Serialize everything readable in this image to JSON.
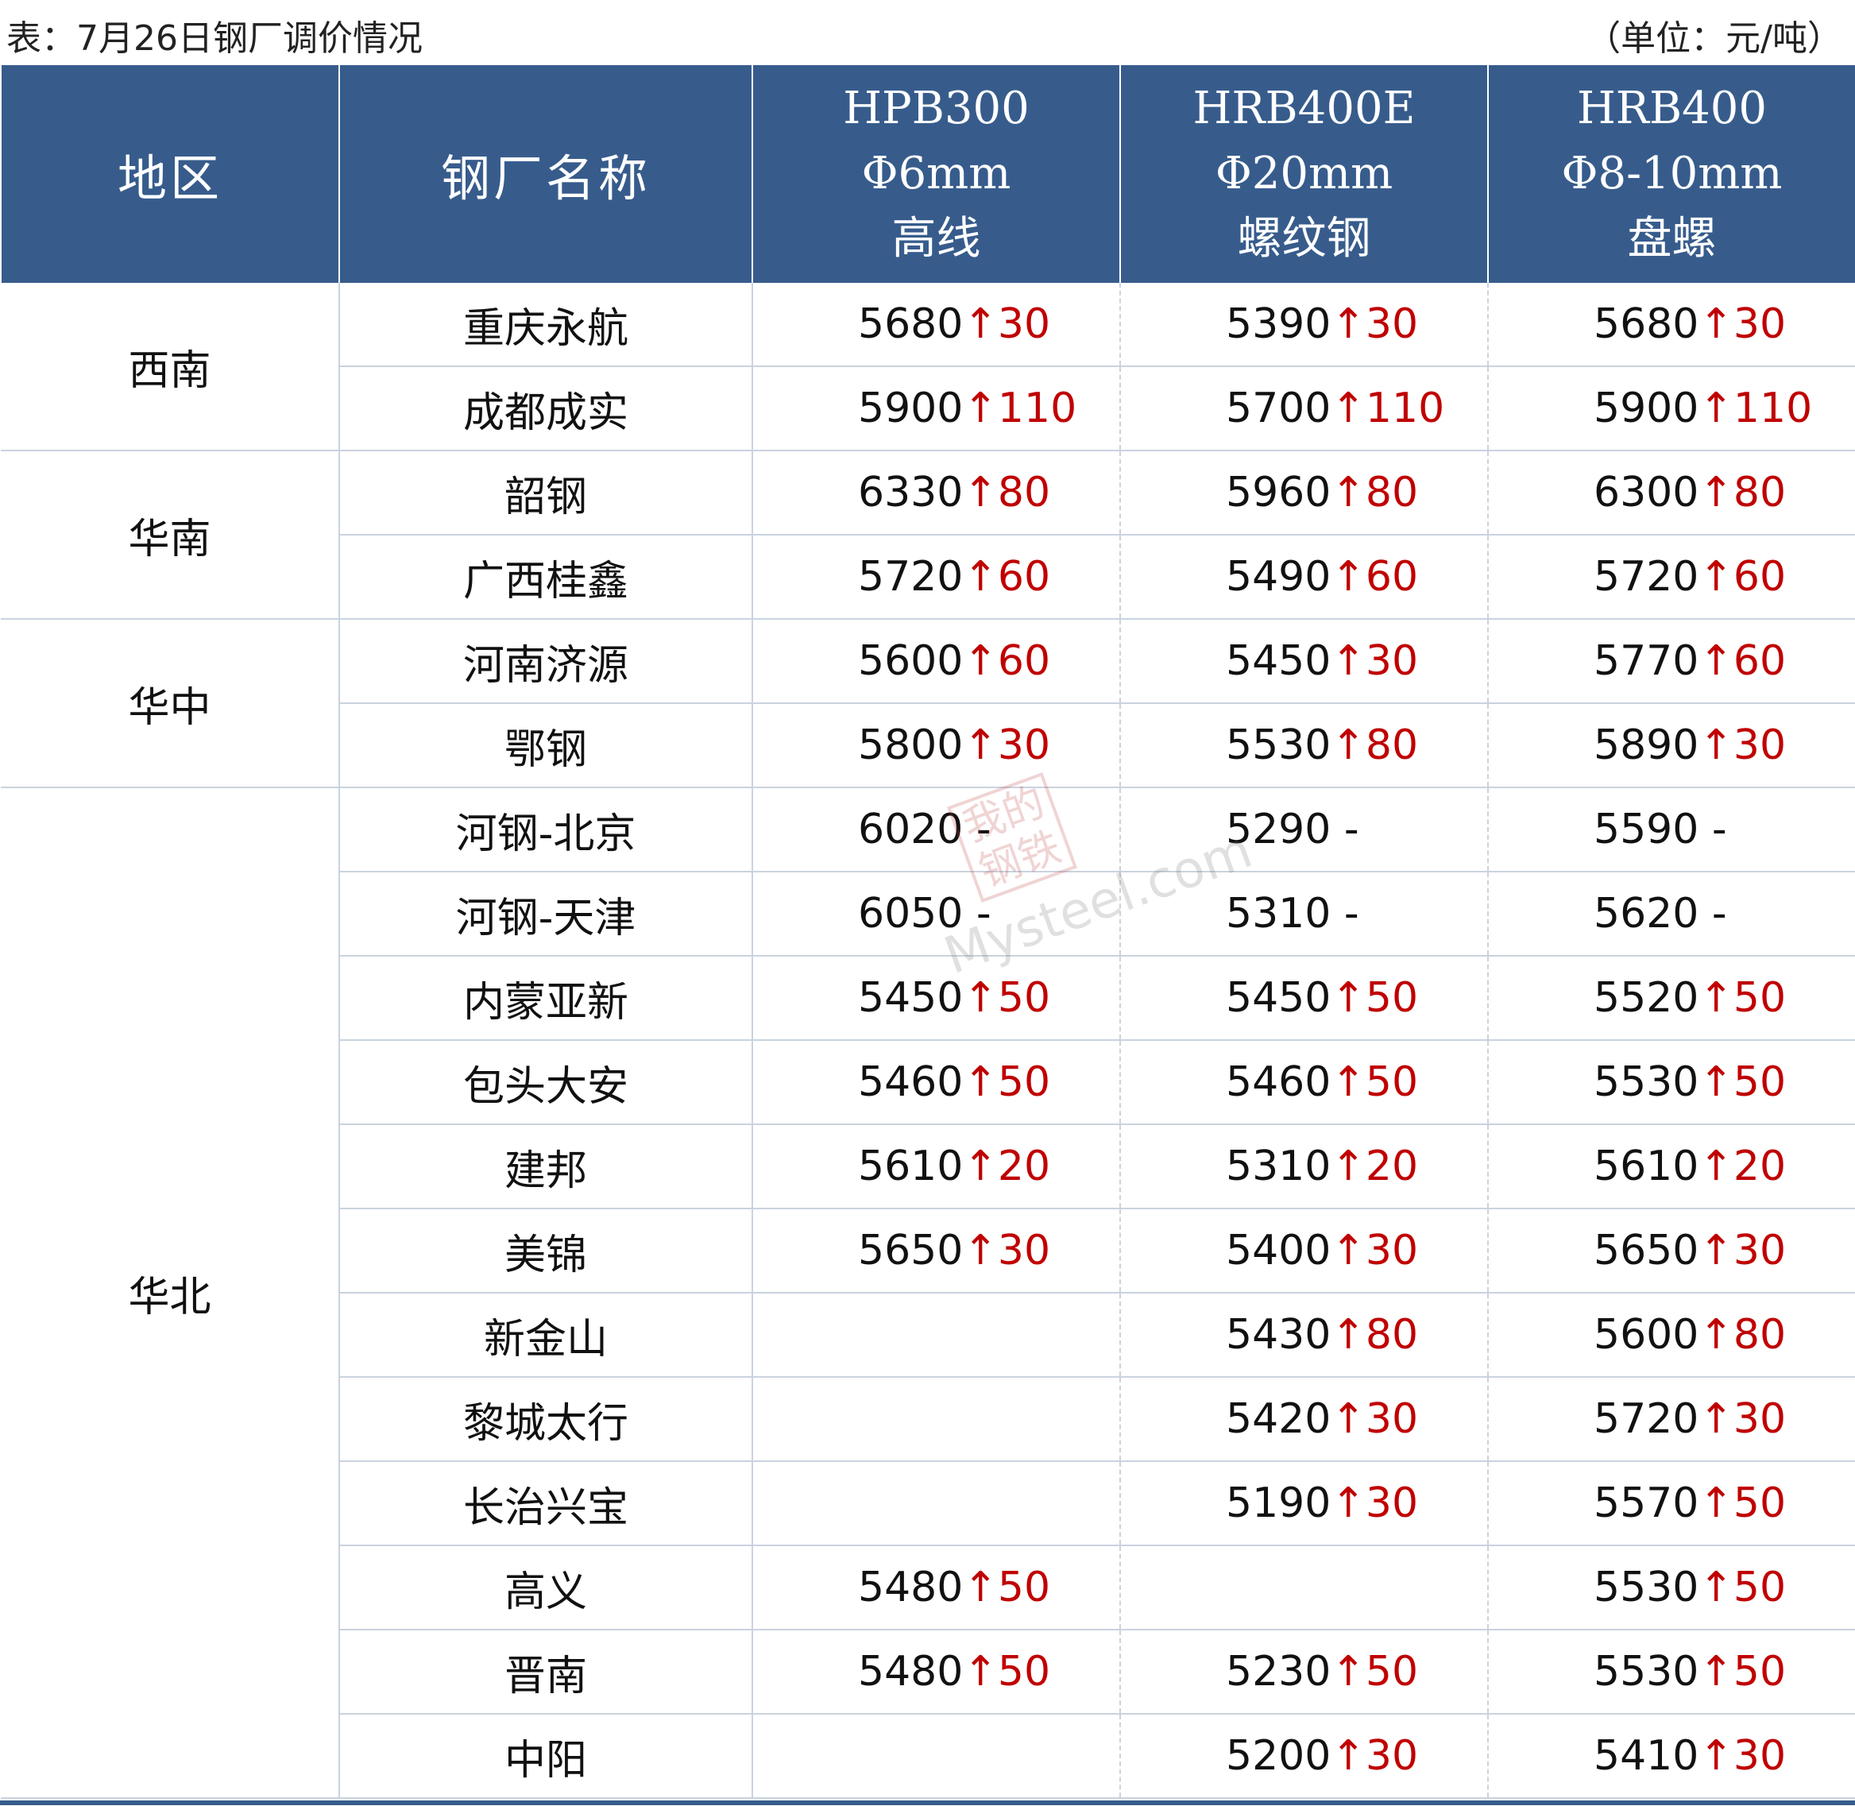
{
  "caption": "表：7月26日钢厂调价情况",
  "unit": "（单位：元/吨）",
  "header": {
    "region": "地区",
    "mill": "钢厂名称",
    "products": [
      {
        "grade": "HPB300",
        "spec": "Φ6mm",
        "type": "高线"
      },
      {
        "grade": "HRB400E",
        "spec": "Φ20mm",
        "type": "螺纹钢"
      },
      {
        "grade": "HRB400",
        "spec": "Φ8-10mm",
        "type": "盘螺"
      }
    ]
  },
  "rows": [
    {
      "region": "西南",
      "span": 2,
      "mill": "重庆永航",
      "prices": [
        {
          "value": "5680",
          "change": "↑30"
        },
        {
          "value": "5390",
          "change": "↑30"
        },
        {
          "value": "5680",
          "change": "↑30"
        }
      ]
    },
    {
      "mill": "成都成实",
      "prices": [
        {
          "value": "5900",
          "change": "↑110"
        },
        {
          "value": "5700",
          "change": "↑110"
        },
        {
          "value": "5900",
          "change": "↑110"
        }
      ]
    },
    {
      "region": "华南",
      "span": 2,
      "mill": "韶钢",
      "prices": [
        {
          "value": "6330",
          "change": "↑80"
        },
        {
          "value": "5960",
          "change": "↑80"
        },
        {
          "value": "6300",
          "change": "↑80"
        }
      ]
    },
    {
      "mill": "广西桂鑫",
      "prices": [
        {
          "value": "5720",
          "change": "↑60"
        },
        {
          "value": "5490",
          "change": "↑60"
        },
        {
          "value": "5720",
          "change": "↑60"
        }
      ]
    },
    {
      "region": "华中",
      "span": 2,
      "mill": "河南济源",
      "prices": [
        {
          "value": "5600",
          "change": "↑60"
        },
        {
          "value": "5450",
          "change": "↑30"
        },
        {
          "value": "5770",
          "change": "↑60"
        }
      ]
    },
    {
      "mill": "鄂钢",
      "prices": [
        {
          "value": "5800",
          "change": "↑30"
        },
        {
          "value": "5530",
          "change": "↑80"
        },
        {
          "value": "5890",
          "change": "↑30"
        }
      ]
    },
    {
      "region": "华北",
      "span": 12,
      "mill": "河钢-北京",
      "prices": [
        {
          "value": "6020",
          "change": "-",
          "flat": true
        },
        {
          "value": "5290",
          "change": "-",
          "flat": true
        },
        {
          "value": "5590",
          "change": "-",
          "flat": true
        }
      ]
    },
    {
      "mill": "河钢-天津",
      "prices": [
        {
          "value": "6050",
          "change": "-",
          "flat": true
        },
        {
          "value": "5310",
          "change": "-",
          "flat": true
        },
        {
          "value": "5620",
          "change": "-",
          "flat": true
        }
      ]
    },
    {
      "mill": "内蒙亚新",
      "prices": [
        {
          "value": "5450",
          "change": "↑50"
        },
        {
          "value": "5450",
          "change": "↑50"
        },
        {
          "value": "5520",
          "change": "↑50"
        }
      ]
    },
    {
      "mill": "包头大安",
      "prices": [
        {
          "value": "5460",
          "change": "↑50"
        },
        {
          "value": "5460",
          "change": "↑50"
        },
        {
          "value": "5530",
          "change": "↑50"
        }
      ]
    },
    {
      "mill": "建邦",
      "prices": [
        {
          "value": "5610",
          "change": "↑20"
        },
        {
          "value": "5310",
          "change": "↑20"
        },
        {
          "value": "5610",
          "change": "↑20"
        }
      ]
    },
    {
      "mill": "美锦",
      "prices": [
        {
          "value": "5650",
          "change": "↑30"
        },
        {
          "value": "5400",
          "change": "↑30"
        },
        {
          "value": "5650",
          "change": "↑30"
        }
      ]
    },
    {
      "mill": "新金山",
      "prices": [
        null,
        {
          "value": "5430",
          "change": "↑80"
        },
        {
          "value": "5600",
          "change": "↑80"
        }
      ]
    },
    {
      "mill": "黎城太行",
      "prices": [
        null,
        {
          "value": "5420",
          "change": "↑30"
        },
        {
          "value": "5720",
          "change": "↑30"
        }
      ]
    },
    {
      "mill": "长治兴宝",
      "prices": [
        null,
        {
          "value": "5190",
          "change": "↑30"
        },
        {
          "value": "5570",
          "change": "↑50"
        }
      ]
    },
    {
      "mill": "高义",
      "prices": [
        {
          "value": "5480",
          "change": "↑50"
        },
        null,
        {
          "value": "5530",
          "change": "↑50"
        }
      ]
    },
    {
      "mill": "晋南",
      "prices": [
        {
          "value": "5480",
          "change": "↑50"
        },
        {
          "value": "5230",
          "change": "↑50"
        },
        {
          "value": "5530",
          "change": "↑50"
        }
      ]
    },
    {
      "mill": "中阳",
      "prices": [
        null,
        {
          "value": "5200",
          "change": "↑30"
        },
        {
          "value": "5410",
          "change": "↑30"
        }
      ]
    }
  ],
  "watermark": {
    "logo": "我的钢铁",
    "site": "Mysteel.com"
  },
  "colors": {
    "header_bg": "#375c8c",
    "increase": "#c00000",
    "grid": "#c9d3df"
  }
}
